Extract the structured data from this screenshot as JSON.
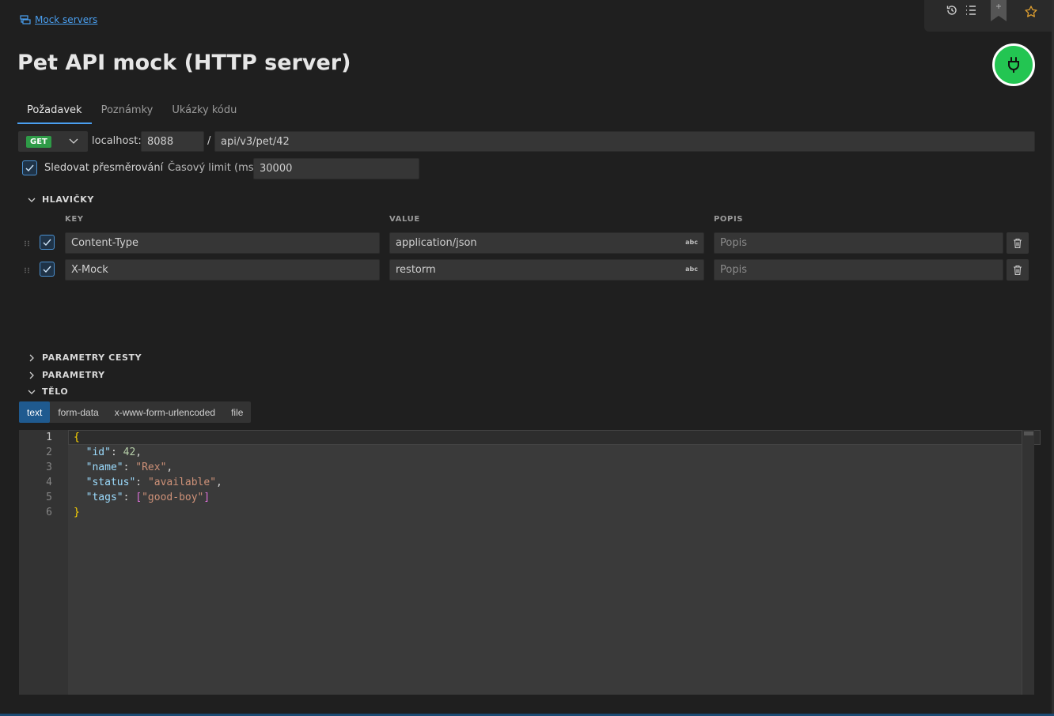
{
  "breadcrumb": {
    "link_label": "Mock servers",
    "icon": "server-icon"
  },
  "title": "Pet API mock (HTTP server)",
  "toolbar": {
    "icons": [
      "history-icon",
      "list-icon",
      "bookmark-icon",
      "star-icon"
    ]
  },
  "power": {
    "icon": "plug-icon",
    "state_color": "#23c552"
  },
  "tabs": [
    {
      "label": "Požadavek",
      "active": true
    },
    {
      "label": "Poznámky",
      "active": false
    },
    {
      "label": "Ukázky kódu",
      "active": false
    }
  ],
  "request": {
    "method": "GET",
    "method_color": "#2e9b47",
    "host_label": "localhost:",
    "port": "8088",
    "separator": "/",
    "path": "api/v3/pet/42"
  },
  "options": {
    "follow_redirects_label": "Sledovat přesměrování",
    "follow_redirects_checked": true,
    "timeout_label": "Časový limit (ms)",
    "timeout_value": "30000"
  },
  "headers": {
    "section_label": "HLAVIČKY",
    "columns": {
      "key": "KEY",
      "value": "VALUE",
      "description": "POPIS"
    },
    "rows": [
      {
        "enabled": true,
        "key": "Content-Type",
        "value": "application/json",
        "value_type": "abc",
        "description_placeholder": "Popis"
      },
      {
        "enabled": true,
        "key": "X-Mock",
        "value": "restorm",
        "value_type": "abc",
        "description_placeholder": "Popis"
      }
    ]
  },
  "sections": {
    "path_params": "PARAMETRY CESTY",
    "params": "PARAMETRY",
    "body": "TĚLO"
  },
  "body_types": [
    {
      "label": "text",
      "active": true
    },
    {
      "label": "form-data",
      "active": false
    },
    {
      "label": "x-www-form-urlencoded",
      "active": false
    },
    {
      "label": "file",
      "active": false
    }
  ],
  "editor": {
    "line_numbers": [
      "1",
      "2",
      "3",
      "4",
      "5",
      "6"
    ],
    "lines": [
      "{",
      "  \"id\": 42,",
      "  \"name\": \"Rex\",",
      "  \"status\": \"available\",",
      "  \"tags\": [\"good-boy\"]",
      "}"
    ]
  }
}
